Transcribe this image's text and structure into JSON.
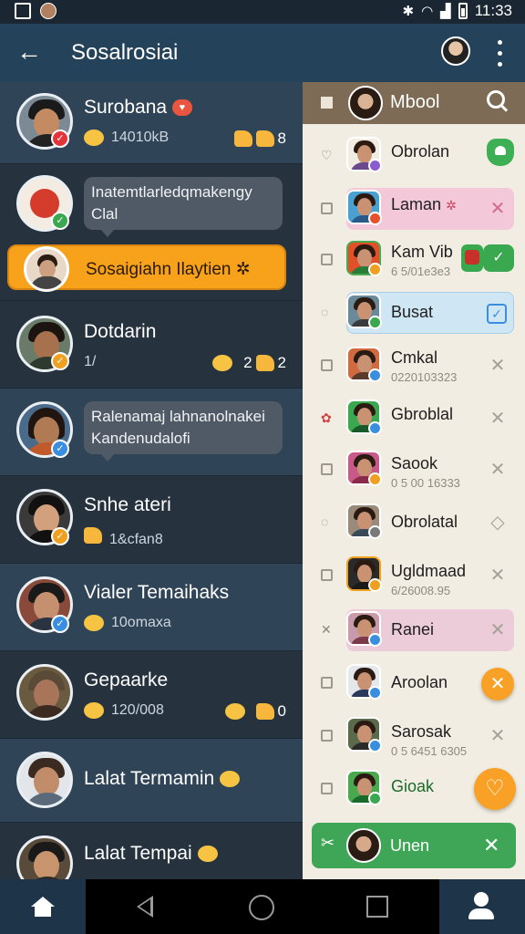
{
  "status_bar": {
    "time": "11:33"
  },
  "app_bar": {
    "title": "Sosalrosiai"
  },
  "left_list": {
    "rows": [
      {
        "name": "Surobana",
        "meta": "14010kB",
        "count": "8"
      },
      {
        "bubble": "Inatemtlarledqmakengy Clal"
      },
      {
        "pill_text": "Sosaigiahn Ilaytien"
      },
      {
        "name": "Dotdarin",
        "meta": "1/",
        "count": "2",
        "count2": "2"
      },
      {
        "bubble": "Ralenamaj lahnanolnakei Kandenudalofi"
      },
      {
        "name": "Snhe ateri",
        "meta": "1&cfan8"
      },
      {
        "name": "Vialer Temaihaks",
        "meta": "10omaxa"
      },
      {
        "name": "Gepaarke",
        "meta": "120/008",
        "count": "0"
      },
      {
        "name": "Lalat Termamin"
      },
      {
        "name": "Lalat Tempai"
      }
    ]
  },
  "right_panel": {
    "header_title": "Mbool",
    "rows": [
      {
        "name": "Obrolan",
        "sub": ""
      },
      {
        "name": "Laman",
        "sub": ""
      },
      {
        "name": "Kam Vib",
        "sub": "6 5/01e3e3"
      },
      {
        "name": "Busat",
        "sub": ""
      },
      {
        "name": "Cmkal",
        "sub": "0220103323"
      },
      {
        "name": "Gbroblal",
        "sub": ""
      },
      {
        "name": "Saook",
        "sub": "0 5 00 16333"
      },
      {
        "name": "Obrolatal",
        "sub": ""
      },
      {
        "name": "Ugldmaad",
        "sub": "6/26008.95"
      },
      {
        "name": "Ranei",
        "sub": ""
      },
      {
        "name": "Aroolan",
        "sub": ""
      },
      {
        "name": "Sarosak",
        "sub": "0 5 6451 6305"
      },
      {
        "name": "Gioak",
        "sub": ""
      }
    ],
    "green_bar_text": "Unen"
  },
  "colors": {
    "app_bar": "#24425a",
    "accent_orange": "#f7a21a",
    "accent_green": "#3fa657",
    "panel_bg": "#f2ede2"
  }
}
